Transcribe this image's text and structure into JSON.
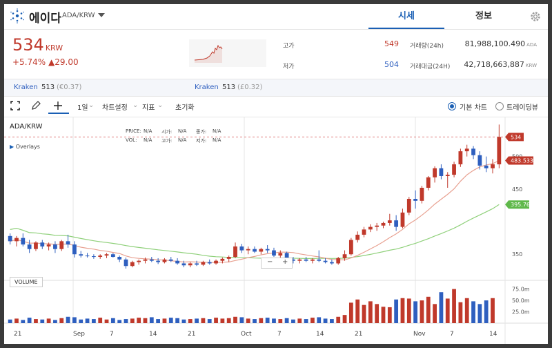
{
  "header": {
    "coin_name": "에이다",
    "pair": "ADA/KRW",
    "tabs": [
      {
        "label": "시세",
        "active": true
      },
      {
        "label": "정보",
        "active": false
      }
    ]
  },
  "summary": {
    "price": "534",
    "price_unit": "KRW",
    "change_pct": "+5.74%",
    "change_abs": "▲29.00",
    "high_label": "고가",
    "high": "549",
    "low_label": "저가",
    "low": "504",
    "volume_label": "거래량(24h)",
    "volume": "81,988,100.490",
    "volume_unit": "ADA",
    "value_label": "거래대금(24H)",
    "value": "42,718,663,887",
    "value_unit": "KRW"
  },
  "exchanges": [
    {
      "name": "Kraken",
      "price": "513",
      "ref": "(€0.37)"
    },
    {
      "name": "Kraken",
      "price": "513",
      "ref": "(£0.32)"
    }
  ],
  "toolbar": {
    "interval": "1일",
    "chart_settings": "차트설정",
    "indicators": "지표",
    "reset": "초기화",
    "basic_chart": "기본 차트",
    "tradingview": "트레이딩뷰"
  },
  "chart": {
    "symbol": "ADA/KRW",
    "ohlc": {
      "price_label": "PRICE:",
      "vol_label": "VOL:",
      "open_label": "시가:",
      "high_label": "고가:",
      "low_label": "저가:",
      "close_label": "종가:",
      "na": "N/A"
    },
    "overlays": "Overlays",
    "volume_label": "VOLUME",
    "zoom_minus": "−",
    "zoom_plus": "+",
    "price_axis": [
      "500",
      "450",
      "350"
    ],
    "volume_axis": [
      "75.0m",
      "50.0m",
      "25.0m"
    ],
    "x_axis": [
      "21",
      "Sep",
      "7",
      "14",
      "21",
      "Oct",
      "7",
      "14",
      "21",
      "Nov",
      "7",
      "14"
    ],
    "last_price_tag": "534",
    "ma_short_tag": "483.533",
    "ma_long_tag": "395.76",
    "colors": {
      "up": "#c0392b",
      "down": "#2e5fbf",
      "ma_short": "#e8a090",
      "ma_long": "#8fd07a"
    }
  },
  "chart_data": {
    "type": "candlestick",
    "ylim": [
      310,
      560
    ],
    "candles": [
      {
        "o": 378,
        "h": 382,
        "l": 365,
        "c": 370
      },
      {
        "o": 370,
        "h": 378,
        "l": 362,
        "c": 375
      },
      {
        "o": 375,
        "h": 382,
        "l": 362,
        "c": 365
      },
      {
        "o": 365,
        "h": 372,
        "l": 352,
        "c": 358
      },
      {
        "o": 358,
        "h": 370,
        "l": 355,
        "c": 368
      },
      {
        "o": 368,
        "h": 372,
        "l": 358,
        "c": 362
      },
      {
        "o": 362,
        "h": 368,
        "l": 356,
        "c": 365
      },
      {
        "o": 365,
        "h": 370,
        "l": 352,
        "c": 358
      },
      {
        "o": 358,
        "h": 372,
        "l": 355,
        "c": 370
      },
      {
        "o": 370,
        "h": 380,
        "l": 360,
        "c": 365
      },
      {
        "o": 365,
        "h": 370,
        "l": 345,
        "c": 350
      },
      {
        "o": 350,
        "h": 355,
        "l": 345,
        "c": 348
      },
      {
        "o": 348,
        "h": 352,
        "l": 345,
        "c": 347
      },
      {
        "o": 347,
        "h": 350,
        "l": 343,
        "c": 346
      },
      {
        "o": 346,
        "h": 350,
        "l": 343,
        "c": 348
      },
      {
        "o": 348,
        "h": 352,
        "l": 344,
        "c": 350
      },
      {
        "o": 350,
        "h": 352,
        "l": 345,
        "c": 346
      },
      {
        "o": 346,
        "h": 348,
        "l": 338,
        "c": 342
      },
      {
        "o": 342,
        "h": 345,
        "l": 328,
        "c": 332
      },
      {
        "o": 332,
        "h": 340,
        "l": 330,
        "c": 338
      },
      {
        "o": 338,
        "h": 342,
        "l": 334,
        "c": 340
      },
      {
        "o": 340,
        "h": 345,
        "l": 336,
        "c": 342
      },
      {
        "o": 342,
        "h": 346,
        "l": 338,
        "c": 340
      },
      {
        "o": 340,
        "h": 344,
        "l": 335,
        "c": 338
      },
      {
        "o": 338,
        "h": 344,
        "l": 336,
        "c": 342
      },
      {
        "o": 342,
        "h": 346,
        "l": 338,
        "c": 340
      },
      {
        "o": 340,
        "h": 344,
        "l": 334,
        "c": 336
      },
      {
        "o": 336,
        "h": 340,
        "l": 330,
        "c": 333
      },
      {
        "o": 333,
        "h": 338,
        "l": 330,
        "c": 336
      },
      {
        "o": 336,
        "h": 340,
        "l": 332,
        "c": 334
      },
      {
        "o": 334,
        "h": 340,
        "l": 332,
        "c": 338
      },
      {
        "o": 338,
        "h": 342,
        "l": 334,
        "c": 336
      },
      {
        "o": 336,
        "h": 342,
        "l": 334,
        "c": 340
      },
      {
        "o": 340,
        "h": 345,
        "l": 336,
        "c": 343
      },
      {
        "o": 343,
        "h": 348,
        "l": 338,
        "c": 346
      },
      {
        "o": 346,
        "h": 368,
        "l": 344,
        "c": 362
      },
      {
        "o": 362,
        "h": 366,
        "l": 352,
        "c": 356
      },
      {
        "o": 356,
        "h": 362,
        "l": 350,
        "c": 358
      },
      {
        "o": 358,
        "h": 362,
        "l": 352,
        "c": 354
      },
      {
        "o": 354,
        "h": 360,
        "l": 350,
        "c": 358
      },
      {
        "o": 358,
        "h": 364,
        "l": 352,
        "c": 356
      },
      {
        "o": 356,
        "h": 360,
        "l": 346,
        "c": 348
      },
      {
        "o": 348,
        "h": 356,
        "l": 344,
        "c": 352
      },
      {
        "o": 352,
        "h": 354,
        "l": 338,
        "c": 342
      },
      {
        "o": 342,
        "h": 346,
        "l": 336,
        "c": 340
      },
      {
        "o": 340,
        "h": 344,
        "l": 336,
        "c": 342
      },
      {
        "o": 342,
        "h": 346,
        "l": 338,
        "c": 340
      },
      {
        "o": 340,
        "h": 344,
        "l": 336,
        "c": 342
      },
      {
        "o": 342,
        "h": 356,
        "l": 338,
        "c": 340
      },
      {
        "o": 340,
        "h": 344,
        "l": 336,
        "c": 338
      },
      {
        "o": 338,
        "h": 342,
        "l": 334,
        "c": 336
      },
      {
        "o": 336,
        "h": 346,
        "l": 334,
        "c": 344
      },
      {
        "o": 344,
        "h": 356,
        "l": 340,
        "c": 350
      },
      {
        "o": 350,
        "h": 375,
        "l": 348,
        "c": 372
      },
      {
        "o": 372,
        "h": 385,
        "l": 368,
        "c": 380
      },
      {
        "o": 380,
        "h": 392,
        "l": 376,
        "c": 388
      },
      {
        "o": 388,
        "h": 396,
        "l": 384,
        "c": 392
      },
      {
        "o": 392,
        "h": 398,
        "l": 386,
        "c": 394
      },
      {
        "o": 394,
        "h": 400,
        "l": 390,
        "c": 398
      },
      {
        "o": 398,
        "h": 412,
        "l": 394,
        "c": 402
      },
      {
        "o": 402,
        "h": 410,
        "l": 386,
        "c": 392
      },
      {
        "o": 392,
        "h": 420,
        "l": 390,
        "c": 414
      },
      {
        "o": 414,
        "h": 438,
        "l": 410,
        "c": 435
      },
      {
        "o": 435,
        "h": 448,
        "l": 420,
        "c": 432
      },
      {
        "o": 432,
        "h": 455,
        "l": 428,
        "c": 452
      },
      {
        "o": 452,
        "h": 470,
        "l": 448,
        "c": 468
      },
      {
        "o": 468,
        "h": 485,
        "l": 460,
        "c": 482
      },
      {
        "o": 482,
        "h": 488,
        "l": 465,
        "c": 470
      },
      {
        "o": 470,
        "h": 476,
        "l": 452,
        "c": 472
      },
      {
        "o": 472,
        "h": 492,
        "l": 468,
        "c": 488
      },
      {
        "o": 488,
        "h": 512,
        "l": 484,
        "c": 508
      },
      {
        "o": 508,
        "h": 518,
        "l": 500,
        "c": 512
      },
      {
        "o": 512,
        "h": 516,
        "l": 496,
        "c": 502
      },
      {
        "o": 502,
        "h": 508,
        "l": 480,
        "c": 486
      },
      {
        "o": 486,
        "h": 500,
        "l": 476,
        "c": 482
      },
      {
        "o": 482,
        "h": 496,
        "l": 474,
        "c": 488
      },
      {
        "o": 488,
        "h": 549,
        "l": 482,
        "c": 530
      }
    ],
    "volumes": [
      8,
      10,
      7,
      12,
      9,
      8,
      10,
      7,
      11,
      14,
      13,
      8,
      10,
      9,
      12,
      8,
      11,
      7,
      9,
      10,
      12,
      11,
      13,
      9,
      10,
      12,
      11,
      8,
      9,
      10,
      11,
      9,
      12,
      10,
      11,
      14,
      13,
      10,
      9,
      11,
      12,
      10,
      9,
      11,
      8,
      10,
      9,
      12,
      13,
      10,
      9,
      14,
      18,
      45,
      52,
      40,
      48,
      42,
      36,
      35,
      52,
      55,
      54,
      48,
      50,
      58,
      42,
      68,
      54,
      75,
      46,
      55,
      48,
      42,
      50,
      55
    ]
  }
}
